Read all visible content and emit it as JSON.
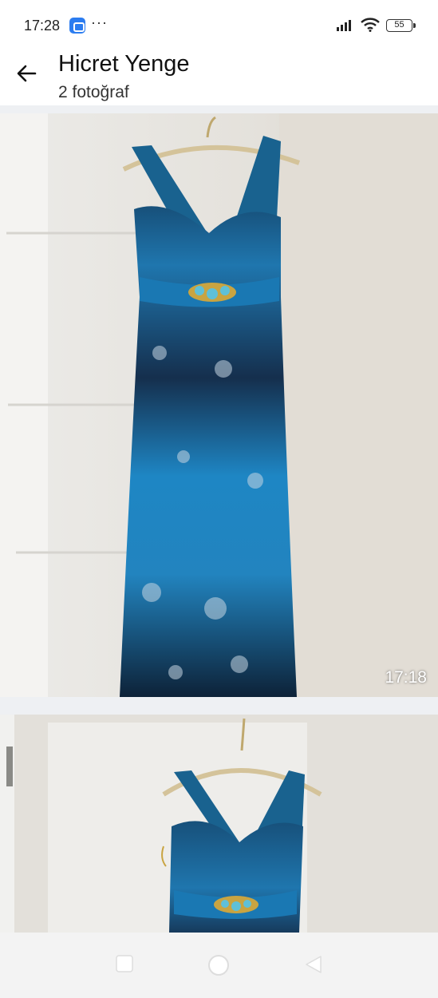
{
  "status_bar": {
    "time": "17:28",
    "more": "···",
    "battery": "55"
  },
  "header": {
    "title": "Hicret Yenge",
    "subtitle": "2 fotoğraf"
  },
  "photos": [
    {
      "timestamp": "17:18"
    },
    {
      "timestamp": ""
    }
  ],
  "colors": {
    "dress_blue": "#1d7cb6",
    "dress_dark": "#0e2a44",
    "wall": "#d8d4cc"
  }
}
